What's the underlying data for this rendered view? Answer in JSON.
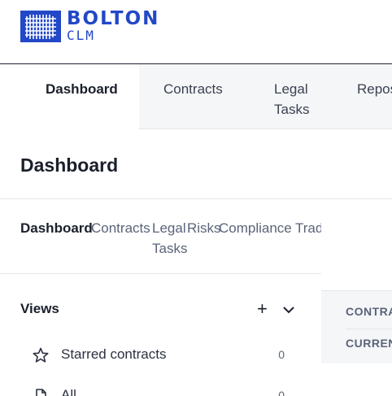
{
  "logo": {
    "name": "BOLTON",
    "sub": "CLM",
    "color": "#2348c7"
  },
  "topnav": {
    "items": [
      {
        "label": "Dashboard",
        "active": true
      },
      {
        "label": "Contracts"
      },
      {
        "label": "Legal\nTasks"
      },
      {
        "label": "Repos"
      }
    ]
  },
  "page": {
    "title": "Dashboard"
  },
  "subtabs": [
    {
      "label": "Dashboard",
      "active": true
    },
    {
      "label": "Contracts"
    },
    {
      "label": "Legal\nTasks"
    },
    {
      "label": "Risks"
    },
    {
      "label": "Compliance"
    },
    {
      "label": "Trad"
    }
  ],
  "views": {
    "title": "Views",
    "items": [
      {
        "label": "Starred contracts",
        "count": "0",
        "icon": "star-icon"
      },
      {
        "label": "All",
        "count": "0",
        "icon": "document-icon"
      }
    ]
  },
  "rpanel": {
    "row1": "CONTRA",
    "row2": "CURREN"
  }
}
